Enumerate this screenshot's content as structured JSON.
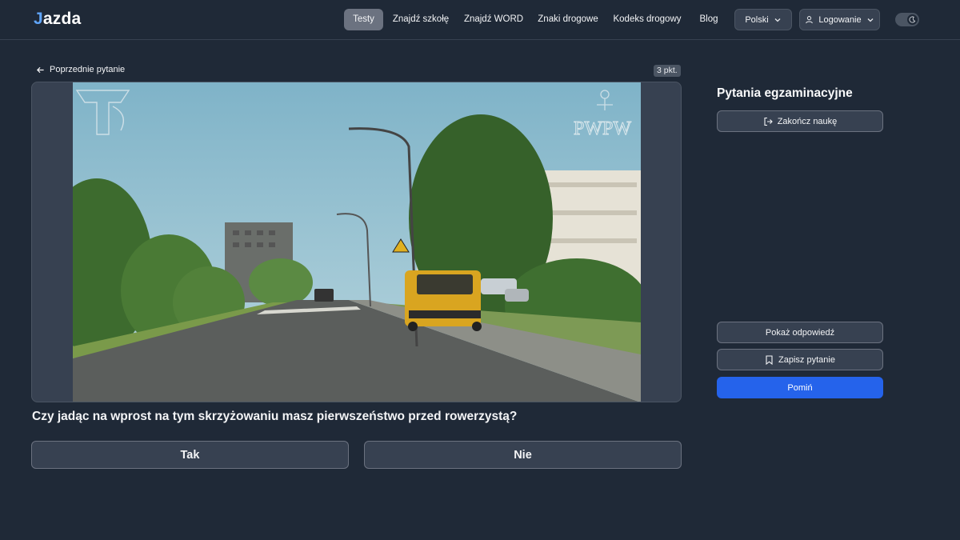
{
  "header": {
    "logo": "Jazda",
    "nav": [
      "Testy",
      "Znajdź szkołę",
      "Znajdź WORD",
      "Znaki drogowe",
      "Kodeks drogowy",
      "Blog"
    ],
    "active_nav": "Testy",
    "language": "Polski",
    "login": "Logowanie"
  },
  "main": {
    "back_label": "Poprzednie pytanie",
    "points": "3 pkt.",
    "watermark_right": "PWPW",
    "question": "Czy jadąc na wprost na tym skrzyżowaniu masz pierwszeństwo przed rowerzystą?",
    "answers": [
      "Tak",
      "Nie"
    ]
  },
  "sidebar": {
    "title": "Pytania egzaminacyjne",
    "finish_label": "Zakończ naukę",
    "show_answer_label": "Pokaż odpowiedź",
    "save_label": "Zapisz pytanie",
    "skip_label": "Pomiń"
  },
  "colors": {
    "background": "#1f2937",
    "primary": "#2563eb",
    "active_tab": "#6b7280"
  }
}
